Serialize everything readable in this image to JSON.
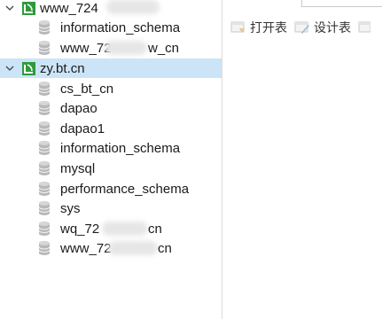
{
  "tree": {
    "connections": [
      {
        "label": "www_724",
        "expanded": true,
        "selected": false
      },
      {
        "label": "zy.bt.cn",
        "expanded": true,
        "selected": true
      }
    ],
    "conn1_databases": [
      "information_schema",
      "www_72",
      "w_cn"
    ],
    "conn2_databases": [
      "cs_bt_cn",
      "dapao",
      "dapao1",
      "information_schema",
      "mysql",
      "performance_schema",
      "sys",
      "wq_72",
      "cn",
      "www_72",
      "cn"
    ]
  },
  "toolbar": {
    "open_table": "打开表",
    "design_table": "设计表"
  },
  "colors": {
    "selection": "#cce4f7",
    "conn_icon": "#2e9a3d",
    "db_icon": "#b8b8b8"
  }
}
